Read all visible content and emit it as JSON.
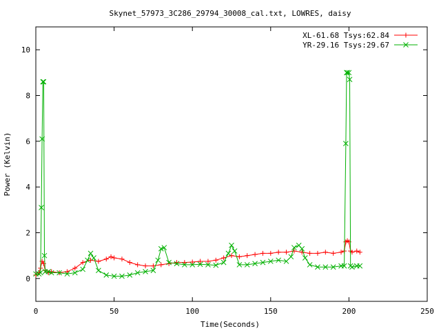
{
  "chart_data": {
    "type": "line",
    "title": "Skynet_57973_3C286_29794_30008_cal.txt, LOWRES, daisy",
    "xlabel": "Time(Seconds)",
    "ylabel": "Power (Kelvin)",
    "xlim": [
      0,
      250
    ],
    "ylim": [
      -1,
      11
    ],
    "xticks": [
      0,
      50,
      100,
      150,
      200,
      250
    ],
    "yticks": [
      0,
      2,
      4,
      6,
      8,
      10
    ],
    "grid": false,
    "legend_position": "top-right",
    "series": [
      {
        "name": "XL-61.68 Tsys:62.84",
        "color": "#ff0000",
        "marker": "plus",
        "x": [
          0,
          2,
          3,
          4,
          5,
          6,
          8,
          10,
          15,
          20,
          25,
          30,
          35,
          40,
          45,
          48,
          50,
          55,
          60,
          65,
          70,
          75,
          80,
          85,
          90,
          95,
          100,
          105,
          110,
          115,
          120,
          125,
          130,
          135,
          140,
          145,
          150,
          155,
          160,
          165,
          170,
          175,
          180,
          185,
          190,
          195,
          197,
          198,
          199,
          200,
          201,
          202,
          205,
          207
        ],
        "y": [
          0.15,
          0.25,
          0.45,
          0.75,
          0.65,
          0.35,
          0.25,
          0.3,
          0.25,
          0.3,
          0.45,
          0.7,
          0.8,
          0.75,
          0.85,
          0.95,
          0.9,
          0.85,
          0.7,
          0.6,
          0.55,
          0.55,
          0.6,
          0.65,
          0.7,
          0.7,
          0.72,
          0.75,
          0.75,
          0.8,
          0.9,
          1.0,
          0.95,
          1.0,
          1.05,
          1.1,
          1.1,
          1.15,
          1.15,
          1.2,
          1.15,
          1.1,
          1.1,
          1.15,
          1.1,
          1.15,
          1.2,
          1.6,
          1.65,
          1.6,
          1.2,
          1.15,
          1.2,
          1.15
        ]
      },
      {
        "name": "YR-29.16 Tsys:29.67",
        "color": "#00b000",
        "marker": "x",
        "x": [
          0,
          2,
          3,
          3.5,
          4,
          4.5,
          5,
          5.5,
          6,
          8,
          10,
          15,
          20,
          25,
          30,
          33,
          35,
          37,
          40,
          45,
          50,
          55,
          60,
          65,
          70,
          75,
          78,
          80,
          82,
          85,
          90,
          95,
          100,
          105,
          110,
          115,
          120,
          123,
          125,
          127,
          130,
          135,
          140,
          145,
          150,
          155,
          160,
          163,
          165,
          168,
          170,
          172,
          175,
          180,
          185,
          190,
          195,
          197,
          198,
          198.5,
          199,
          200,
          200.5,
          201,
          202,
          205,
          207
        ],
        "y": [
          0.2,
          0.2,
          0.25,
          3.1,
          6.1,
          8.6,
          8.6,
          1.0,
          0.3,
          0.3,
          0.25,
          0.25,
          0.2,
          0.25,
          0.4,
          0.8,
          1.1,
          0.9,
          0.35,
          0.15,
          0.1,
          0.1,
          0.15,
          0.25,
          0.3,
          0.35,
          0.8,
          1.3,
          1.35,
          0.7,
          0.65,
          0.6,
          0.6,
          0.62,
          0.6,
          0.58,
          0.7,
          1.1,
          1.45,
          1.2,
          0.6,
          0.6,
          0.65,
          0.7,
          0.75,
          0.8,
          0.75,
          0.95,
          1.35,
          1.45,
          1.3,
          0.9,
          0.6,
          0.5,
          0.5,
          0.5,
          0.55,
          0.55,
          5.9,
          9.0,
          9.0,
          9.0,
          8.7,
          0.55,
          0.5,
          0.55,
          0.55
        ]
      }
    ]
  }
}
